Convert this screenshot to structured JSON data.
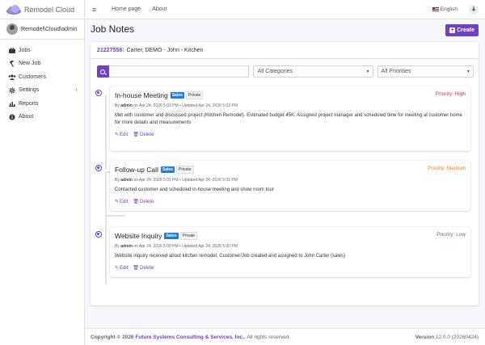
{
  "brand": {
    "name": "Remodel Cloud"
  },
  "user": {
    "name": "Remodel\\Cloud\\admin"
  },
  "sidebar": {
    "items": [
      {
        "label": "Jobs",
        "icon": "briefcase-icon"
      },
      {
        "label": "New Job",
        "icon": "hammer-icon"
      },
      {
        "label": "Customers",
        "icon": "users-icon"
      },
      {
        "label": "Settings",
        "icon": "gear-icon"
      },
      {
        "label": "Reports",
        "icon": "chart-icon"
      },
      {
        "label": "About",
        "icon": "info-icon"
      }
    ]
  },
  "topbar": {
    "links": [
      "Home page",
      "About"
    ],
    "language": "English"
  },
  "page": {
    "title": "Job Notes",
    "create_label": "Create"
  },
  "job": {
    "number": "21227558:",
    "name": "Carter, DEMO - John - Kitchen"
  },
  "filters": {
    "search_placeholder": "",
    "category": "All Categories",
    "priority": "All Priorities"
  },
  "notes": [
    {
      "title": "In-house Meeting",
      "badge_sales": "Sales",
      "badge_private": "Private",
      "priority": "Priority: High",
      "priority_color": "#dc3545",
      "meta_by": "By",
      "meta_user": "admin",
      "meta_rest": "on Apr 24, 2026 5:03 PM • Updated Apr 24, 2026 5:03 PM",
      "body": "Met with customer and discussed project (Kitchen Remodel). Estimated budget 45K. Assigned project manager and scheduled time for meeting at customer home for more details and measurements",
      "edit": "Edit",
      "delete": "Delete"
    },
    {
      "title": "Follow-up Call",
      "badge_sales": "Sales",
      "badge_private": "Private",
      "priority": "Priority: Medium",
      "priority_color": "#fd7e14",
      "meta_by": "By",
      "meta_user": "admin",
      "meta_rest": "on Apr 24, 2026 5:01 PM • Updated Apr 24, 2026 5:01 PM",
      "body": "Contacted customer and scheduled in-house meeting and show room tour",
      "edit": "Edit",
      "delete": "Delete"
    },
    {
      "title": "Website Inquiry",
      "badge_sales": "Sales",
      "badge_private": "Private",
      "priority": "Priority: Low",
      "priority_color": "#6c757d",
      "meta_by": "By",
      "meta_user": "admin",
      "meta_rest": "on Apr 24, 2026 5:00 PM • Updated Apr 24, 2026 5:00 PM",
      "body": "Website inquiry received about kitchen remodel. Customer/Job created and assigned to John Carter (sales)",
      "edit": "Edit",
      "delete": "Delete"
    }
  ],
  "footer": {
    "copyright": "Copyright © 2026",
    "company": "Future Systems Consulting & Services, Inc..",
    "rights": "All rights reserved.",
    "version_label": "Version",
    "version": "12.0.0 (20260424)"
  },
  "colors": {
    "accent": "#6f42c1",
    "sales_badge": "#1f7ce0"
  }
}
